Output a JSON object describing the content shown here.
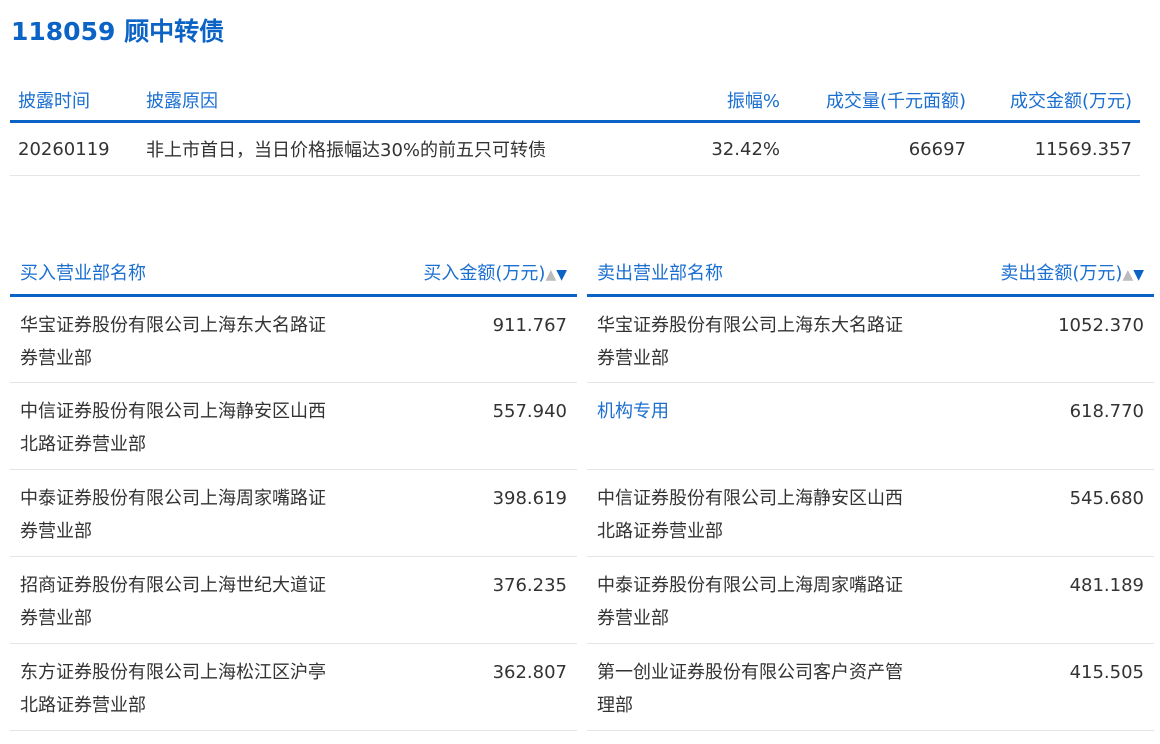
{
  "title": "118059 顾中转债",
  "disclosure": {
    "headers": [
      "披露时间",
      "披露原因",
      "振幅%",
      "成交量(千元面额)",
      "成交金额(万元)"
    ],
    "row": [
      "20260119",
      "非上市首日，当日价格振幅达30%的前五只可转债",
      "32.42%",
      "66697",
      "11569.357"
    ]
  },
  "buy": {
    "headers": [
      "买入营业部名称",
      "买入金额(万元)"
    ],
    "rows": [
      {
        "name": "华宝证券股份有限公司上海东大名路证券营业部",
        "amount": "911.767"
      },
      {
        "name": "中信证券股份有限公司上海静安区山西北路证券营业部",
        "amount": "557.940"
      },
      {
        "name": "中泰证券股份有限公司上海周家嘴路证券营业部",
        "amount": "398.619"
      },
      {
        "name": "招商证券股份有限公司上海世纪大道证券营业部",
        "amount": "376.235"
      },
      {
        "name": "东方证券股份有限公司上海松江区沪亭北路证券营业部",
        "amount": "362.807"
      }
    ]
  },
  "sell": {
    "headers": [
      "卖出营业部名称",
      "卖出金额(万元)"
    ],
    "rows": [
      {
        "name": "华宝证券股份有限公司上海东大名路证券营业部",
        "amount": "1052.370"
      },
      {
        "name": "机构专用",
        "amount": "618.770"
      },
      {
        "name": "中信证券股份有限公司上海静安区山西北路证券营业部",
        "amount": "545.680"
      },
      {
        "name": "中泰证券股份有限公司上海周家嘴路证券营业部",
        "amount": "481.189"
      },
      {
        "name": "第一创业证券股份有限公司客户资产管理部",
        "amount": "415.505"
      }
    ]
  },
  "sort_icons": {
    "up": "▲",
    "down": "▼"
  }
}
